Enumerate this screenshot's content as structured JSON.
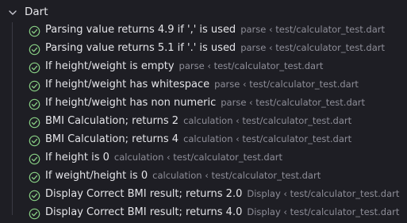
{
  "group": {
    "label": "Dart",
    "chevron_icon": "chevron-down-icon"
  },
  "colors": {
    "background": "#1e1e24",
    "pass": "#89d185",
    "label": "#e4e4e8",
    "description": "#8e8e98"
  },
  "tests": [
    {
      "name": "Parsing value returns 4.9 if ',' is used",
      "description": "parse ‹ test/calculator_test.dart",
      "status": "passed"
    },
    {
      "name": "Parsing value returns 5.1 if '.' is used",
      "description": "parse ‹ test/calculator_test.dart",
      "status": "passed"
    },
    {
      "name": "If height/weight is empty",
      "description": "parse ‹ test/calculator_test.dart",
      "status": "passed"
    },
    {
      "name": "If height/weight has whitespace",
      "description": "parse ‹ test/calculator_test.dart",
      "status": "passed"
    },
    {
      "name": "If height/weight has non numeric",
      "description": "parse ‹ test/calculator_test.dart",
      "status": "passed"
    },
    {
      "name": "BMI Calculation; returns 2",
      "description": "calculation ‹ test/calculator_test.dart",
      "status": "passed"
    },
    {
      "name": "BMI Calculation; returns 4",
      "description": "calculation ‹ test/calculator_test.dart",
      "status": "passed"
    },
    {
      "name": "If height is 0",
      "description": "calculation ‹ test/calculator_test.dart",
      "status": "passed"
    },
    {
      "name": "If weight/height is 0",
      "description": "calculation ‹ test/calculator_test.dart",
      "status": "passed"
    },
    {
      "name": "Display Correct BMI result; returns 2.0",
      "description": "Display ‹ test/calculator_test.dart",
      "status": "passed"
    },
    {
      "name": "Display Correct BMI result; returns 4.0",
      "description": "Display ‹ test/calculator_test.dart",
      "status": "passed"
    }
  ]
}
